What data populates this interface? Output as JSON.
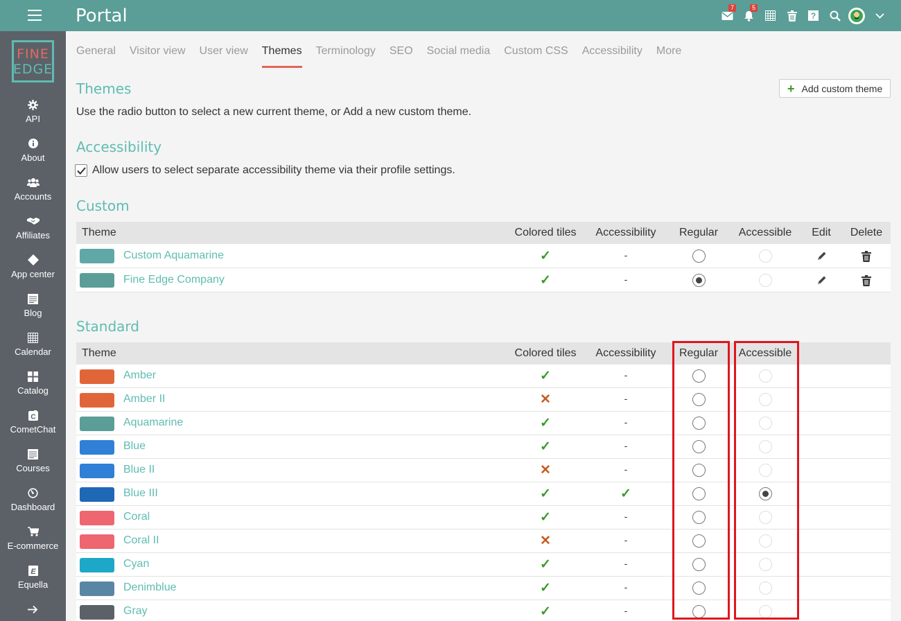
{
  "app": {
    "title": "Portal"
  },
  "topbar": {
    "messages_count": "7",
    "notifications_count": "5"
  },
  "logo": {
    "line1": "FINE",
    "line2": "EDGE"
  },
  "sidebar": {
    "items": [
      {
        "label": "API",
        "icon": "gear-icon"
      },
      {
        "label": "About",
        "icon": "info-icon"
      },
      {
        "label": "Accounts",
        "icon": "users-icon"
      },
      {
        "label": "Affiliates",
        "icon": "handshake-icon"
      },
      {
        "label": "App center",
        "icon": "diamond-icon"
      },
      {
        "label": "Blog",
        "icon": "blog-icon"
      },
      {
        "label": "Calendar",
        "icon": "calendar-icon"
      },
      {
        "label": "Catalog",
        "icon": "grid-icon"
      },
      {
        "label": "CometChat",
        "icon": "cometchat-icon"
      },
      {
        "label": "Courses",
        "icon": "courses-icon"
      },
      {
        "label": "Dashboard",
        "icon": "dashboard-icon"
      },
      {
        "label": "E-commerce",
        "icon": "cart-icon"
      },
      {
        "label": "Equella",
        "icon": "equella-icon"
      },
      {
        "label": "",
        "icon": "arrow-right-icon"
      }
    ]
  },
  "tabs": [
    "General",
    "Visitor view",
    "User view",
    "Themes",
    "Terminology",
    "SEO",
    "Social media",
    "Custom CSS",
    "Accessibility",
    "More"
  ],
  "active_tab": "Themes",
  "themes_section": {
    "heading": "Themes",
    "description": "Use the radio button to select a new current theme, or Add a new custom theme.",
    "add_button": "Add custom theme"
  },
  "accessibility_section": {
    "heading": "Accessibility",
    "checkbox_label": "Allow users to select separate accessibility theme via their profile settings.",
    "checked": true
  },
  "columns": {
    "theme": "Theme",
    "colored_tiles": "Colored tiles",
    "accessibility": "Accessibility",
    "regular": "Regular",
    "accessible": "Accessible",
    "edit": "Edit",
    "delete": "Delete"
  },
  "custom": {
    "heading": "Custom",
    "rows": [
      {
        "name": "Custom Aquamarine",
        "color": "#5fa8a6",
        "tiles": true,
        "accessibility": "-",
        "regular": false,
        "accessible": false
      },
      {
        "name": "Fine Edge Company",
        "color": "#5a9e97",
        "tiles": true,
        "accessibility": "-",
        "regular": true,
        "accessible": false
      }
    ]
  },
  "standard": {
    "heading": "Standard",
    "rows": [
      {
        "name": "Amber",
        "color": "#e0663a",
        "tiles": true,
        "accessibility": "-",
        "regular": false,
        "accessible": false
      },
      {
        "name": "Amber II",
        "color": "#e0663a",
        "tiles": false,
        "accessibility": "-",
        "regular": false,
        "accessible": false
      },
      {
        "name": "Aquamarine",
        "color": "#5a9e97",
        "tiles": true,
        "accessibility": "-",
        "regular": false,
        "accessible": false
      },
      {
        "name": "Blue",
        "color": "#2f80d6",
        "tiles": true,
        "accessibility": "-",
        "regular": false,
        "accessible": false
      },
      {
        "name": "Blue II",
        "color": "#2f80d6",
        "tiles": false,
        "accessibility": "-",
        "regular": false,
        "accessible": false
      },
      {
        "name": "Blue III",
        "color": "#1e68b6",
        "tiles": true,
        "accessibility": "yes",
        "regular": false,
        "accessible": true
      },
      {
        "name": "Coral",
        "color": "#ee6670",
        "tiles": true,
        "accessibility": "-",
        "regular": false,
        "accessible": false
      },
      {
        "name": "Coral II",
        "color": "#ee6670",
        "tiles": false,
        "accessibility": "-",
        "regular": false,
        "accessible": false
      },
      {
        "name": "Cyan",
        "color": "#1ea8c8",
        "tiles": true,
        "accessibility": "-",
        "regular": false,
        "accessible": false
      },
      {
        "name": "Denimblue",
        "color": "#5a86a6",
        "tiles": true,
        "accessibility": "-",
        "regular": false,
        "accessible": false
      },
      {
        "name": "Gray",
        "color": "#5c6168",
        "tiles": true,
        "accessibility": "-",
        "regular": false,
        "accessible": false
      }
    ]
  },
  "colors": {
    "topbar": "#5a9e97",
    "sidebar": "#5c6168",
    "accent": "#5fbcb2",
    "tab_underline": "#e0655b",
    "highlight_box": "#e0161d"
  }
}
